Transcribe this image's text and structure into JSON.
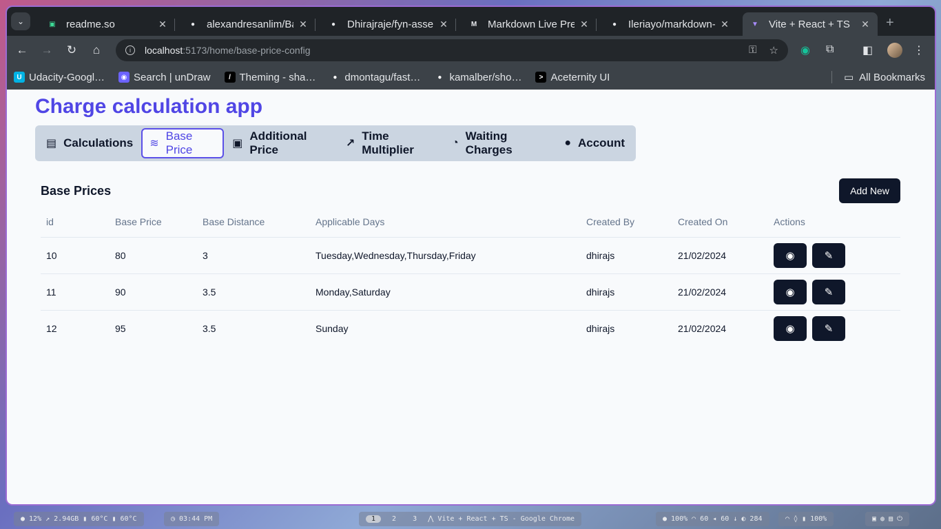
{
  "browser": {
    "tabs": [
      {
        "title": "readme.so",
        "favicon": "readme-icon",
        "color": "#3ddc97",
        "glyph": "▣"
      },
      {
        "title": "alexandresanlim/Ba",
        "favicon": "github-icon",
        "color": "#e8eaed",
        "glyph": "●"
      },
      {
        "title": "Dhirajraje/fyn-asse",
        "favicon": "github-icon",
        "color": "#e8eaed",
        "glyph": "●"
      },
      {
        "title": "Markdown Live Prev",
        "favicon": "markdown-icon",
        "color": "#e8eaed",
        "glyph": "M"
      },
      {
        "title": "Ileriayo/markdown-",
        "favicon": "github-icon",
        "color": "#e8eaed",
        "glyph": "●"
      },
      {
        "title": "Vite + React + TS",
        "favicon": "vite-icon",
        "color": "#a78bfa",
        "glyph": "▼"
      }
    ],
    "close_glyph": "✕",
    "new_tab_glyph": "+",
    "url_host": "localhost",
    "url_path": ":5173/home/base-price-config",
    "bookmarks": [
      {
        "label": "Udacity-Googl…",
        "icon": "udacity-icon",
        "glyph": "U",
        "color": "#02b3e4"
      },
      {
        "label": "Search | unDraw",
        "icon": "undraw-icon",
        "glyph": "◉",
        "color": "#6c63ff"
      },
      {
        "label": "Theming - sha…",
        "icon": "shadcn-icon",
        "glyph": "/",
        "color": "#000000"
      },
      {
        "label": "dmontagu/fast…",
        "icon": "github-icon",
        "glyph": "●",
        "color": "#3c4248"
      },
      {
        "label": "kamalber/sho…",
        "icon": "github-icon",
        "glyph": "●",
        "color": "#3c4248"
      },
      {
        "label": "Aceternity UI",
        "icon": "aceternity-icon",
        "glyph": ">",
        "color": "#000000"
      }
    ],
    "all_bookmarks": "All Bookmarks"
  },
  "app": {
    "title": "Charge calculation app",
    "tabs": [
      {
        "label": "Calculations",
        "icon": "calculator-icon",
        "glyph": "▤"
      },
      {
        "label": "Base Price",
        "icon": "database-icon",
        "glyph": "≋"
      },
      {
        "label": "Additional Price",
        "icon": "banknote-icon",
        "glyph": "▣"
      },
      {
        "label": "Time Multiplier",
        "icon": "trending-up-icon",
        "glyph": "↗"
      },
      {
        "label": "Waiting Charges",
        "icon": "clock-icon",
        "glyph": "◔"
      },
      {
        "label": "Account",
        "icon": "user-icon",
        "glyph": "●"
      }
    ],
    "active_tab": "Base Price",
    "section_title": "Base Prices",
    "add_button": "Add New",
    "table": {
      "headers": [
        "id",
        "Base Price",
        "Base Distance",
        "Applicable Days",
        "Created By",
        "Created On",
        "Actions"
      ],
      "rows": [
        [
          "10",
          "80",
          "3",
          "Tuesday,Wednesday,Thursday,Friday",
          "dhirajs",
          "21/02/2024"
        ],
        [
          "11",
          "90",
          "3.5",
          "Monday,Saturday",
          "dhirajs",
          "21/02/2024"
        ],
        [
          "12",
          "95",
          "3.5",
          "Sunday",
          "dhirajs",
          "21/02/2024"
        ]
      ]
    }
  },
  "taskbar": {
    "stats": "● 12%  ↗ 2.94GB  ▮ 60°C  ▮ 60°C",
    "clock": "◷ 03:44 PM",
    "workspaces": [
      "1",
      "2",
      "3"
    ],
    "window_title": "⋀ Vite + React + TS - Google Chrome",
    "system": "● 100%  ◠ 60  ◂ 60  ↓ ◐ 284",
    "tray": "◠  ◊  ▮ 100%",
    "power": "▣ ◍ ▤ ⏻"
  }
}
